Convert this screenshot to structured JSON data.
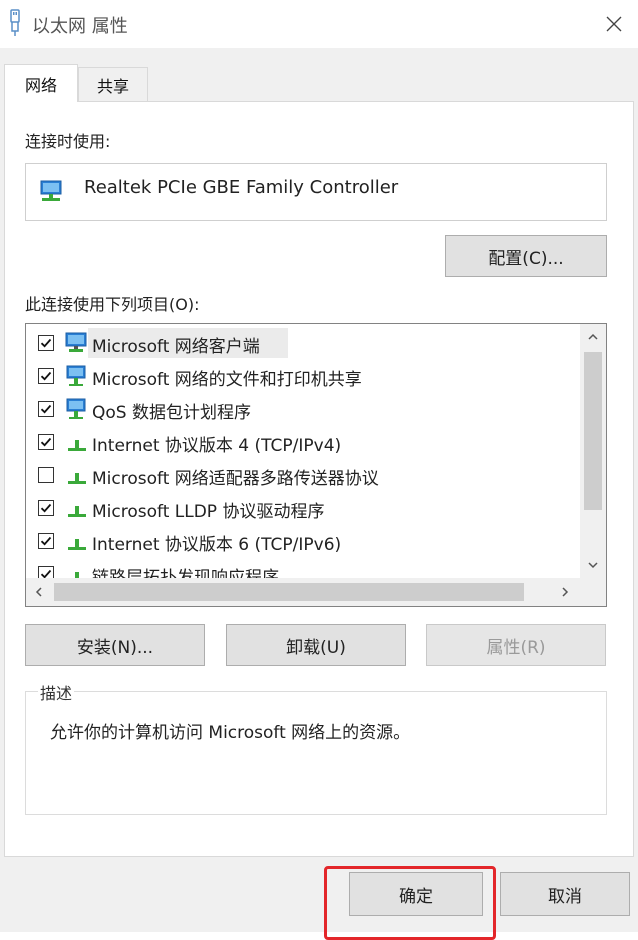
{
  "window": {
    "title": "以太网 属性"
  },
  "tabs": [
    {
      "label": "网络",
      "active": true
    },
    {
      "label": "共享",
      "active": false
    }
  ],
  "connect_using": {
    "label": "连接时使用:",
    "adapter_name": "Realtek PCIe GBE Family Controller",
    "configure_button": "配置(C)..."
  },
  "items_section": {
    "label": "此连接使用下列项目(O):",
    "items": [
      {
        "label": "Microsoft 网络客户端",
        "checked": true,
        "icon": "network-client-icon",
        "selected": true
      },
      {
        "label": "Microsoft 网络的文件和打印机共享",
        "checked": true,
        "icon": "network-service-icon",
        "selected": false
      },
      {
        "label": "QoS 数据包计划程序",
        "checked": true,
        "icon": "network-service-icon",
        "selected": false
      },
      {
        "label": "Internet 协议版本 4 (TCP/IPv4)",
        "checked": true,
        "icon": "protocol-icon",
        "selected": false
      },
      {
        "label": "Microsoft 网络适配器多路传送器协议",
        "checked": false,
        "icon": "protocol-icon",
        "selected": false
      },
      {
        "label": "Microsoft LLDP 协议驱动程序",
        "checked": true,
        "icon": "protocol-icon",
        "selected": false
      },
      {
        "label": "Internet 协议版本 6 (TCP/IPv6)",
        "checked": true,
        "icon": "protocol-icon",
        "selected": false
      },
      {
        "label": "链路层拓扑发现响应程序",
        "checked": true,
        "icon": "protocol-icon",
        "selected": false
      }
    ]
  },
  "buttons": {
    "install": "安装(N)...",
    "uninstall": "卸载(U)",
    "properties": "属性(R)",
    "ok": "确定",
    "cancel": "取消"
  },
  "description": {
    "title": "描述",
    "text": "允许你的计算机访问 Microsoft 网络上的资源。"
  },
  "colors": {
    "highlight": "#e3262a",
    "dialog_bg": "#f0f0f0",
    "protocol_icon": "#3aa93a",
    "monitor_icon": "#2a7fd4"
  }
}
